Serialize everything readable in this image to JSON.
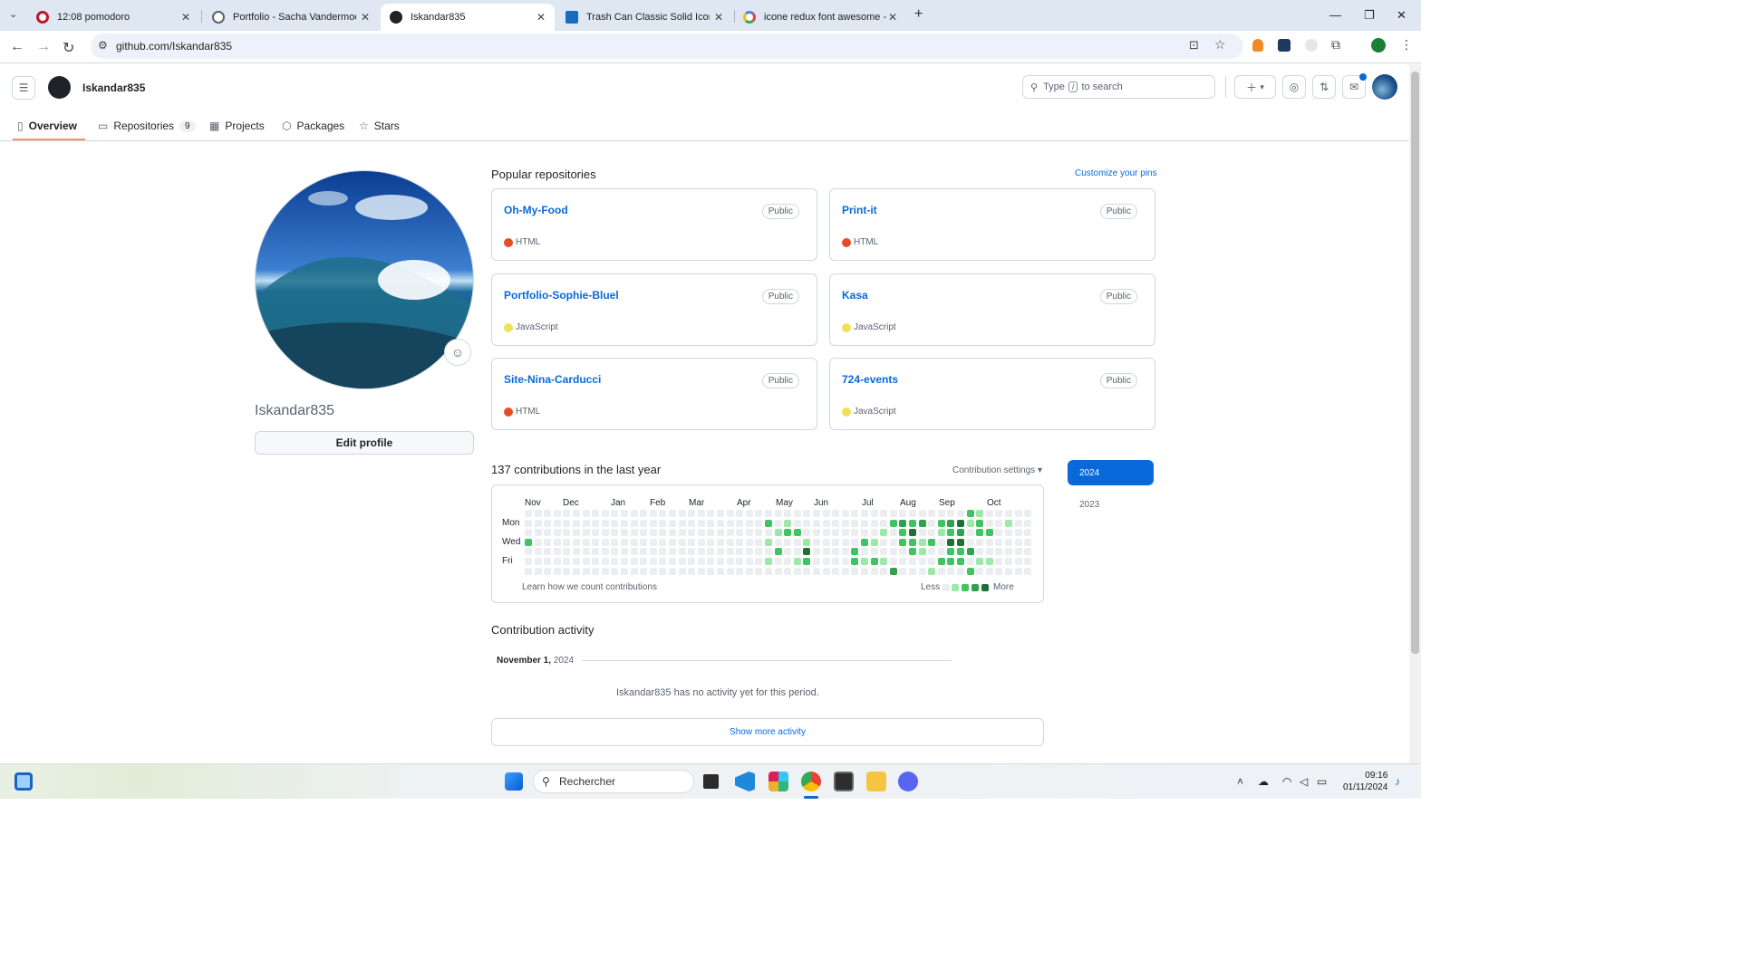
{
  "browser": {
    "tabs": [
      {
        "label": "12:08 pomodoro",
        "icon": "opera-icon",
        "color": "#c0172a"
      },
      {
        "label": "Portfolio - Sacha Vandermoeten",
        "icon": "globe-icon",
        "color": "#5f6368"
      },
      {
        "label": "Iskandar835",
        "icon": "github-icon",
        "color": "#1f2328"
      },
      {
        "label": "Trash Can Classic Solid Icon | Fo",
        "icon": "fontawesome-flag-icon",
        "color": "#146ebe"
      },
      {
        "label": "icone redux font awesome - Re",
        "icon": "google-icon",
        "color": "#4285f4"
      }
    ],
    "url": "github.com/Iskandar835"
  },
  "header": {
    "username": "Iskandar835",
    "search_placeholder_prefix": "Type",
    "search_key": "/",
    "search_placeholder_suffix": "to search"
  },
  "nav": {
    "overview": "Overview",
    "repositories": "Repositories",
    "repositories_count": "9",
    "projects": "Projects",
    "packages": "Packages",
    "stars": "Stars"
  },
  "profile": {
    "username": "Iskandar835",
    "edit_button": "Edit profile"
  },
  "repos": {
    "title": "Popular repositories",
    "customize": "Customize your pins",
    "items": [
      {
        "name": "Oh-My-Food",
        "visibility": "Public",
        "language": "HTML",
        "color": "#e34c26"
      },
      {
        "name": "Print-it",
        "visibility": "Public",
        "language": "HTML",
        "color": "#e34c26"
      },
      {
        "name": "Portfolio-Sophie-Bluel",
        "visibility": "Public",
        "language": "JavaScript",
        "color": "#f1e05a"
      },
      {
        "name": "Kasa",
        "visibility": "Public",
        "language": "JavaScript",
        "color": "#f1e05a"
      },
      {
        "name": "Site-Nina-Carducci",
        "visibility": "Public",
        "language": "HTML",
        "color": "#e34c26"
      },
      {
        "name": "724-events",
        "visibility": "Public",
        "language": "JavaScript",
        "color": "#f1e05a"
      }
    ]
  },
  "contributions": {
    "title": "137 contributions in the last year",
    "settings": "Contribution settings",
    "months": [
      "Nov",
      "Dec",
      "Jan",
      "Feb",
      "Mar",
      "Apr",
      "May",
      "Jun",
      "Jul",
      "Aug",
      "Sep",
      "Oct"
    ],
    "days": [
      "Mon",
      "Wed",
      "Fri"
    ],
    "learn": "Learn how we count contributions",
    "less": "Less",
    "more": "More",
    "years": [
      "2024",
      "2023"
    ],
    "level_colors": [
      "#ebedf0",
      "#9be9a8",
      "#40c463",
      "#30a14e",
      "#216e39"
    ]
  },
  "activity": {
    "title": "Contribution activity",
    "date_bold": "November 1,",
    "date_year": "2024",
    "empty": "Iskandar835 has no activity yet for this period.",
    "show_more": "Show more activity"
  },
  "taskbar": {
    "search": "Rechercher",
    "time": "09:16",
    "date": "01/11/2024"
  }
}
